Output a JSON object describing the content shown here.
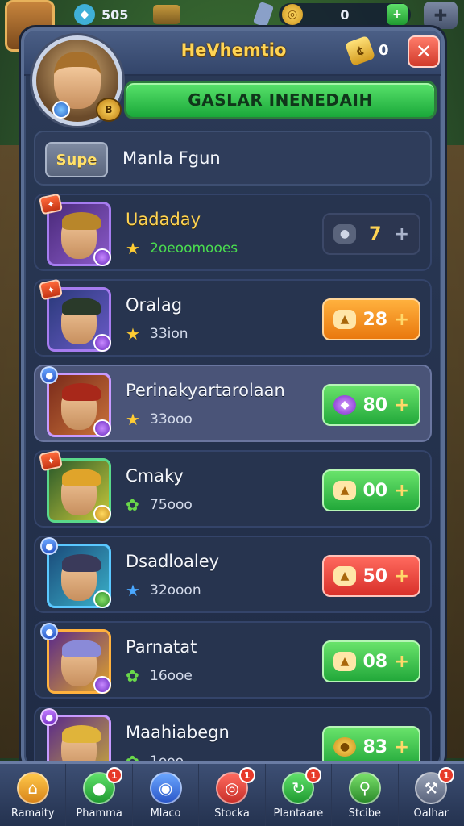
{
  "topbar": {
    "stat_a_value": "505",
    "stat_a_icon": "gem-icon",
    "gold_value": "0",
    "settings_icon": "gear-icon"
  },
  "panel": {
    "title": "HeVhemtio",
    "key_count": "0",
    "key_icon_glyph": "¢",
    "close_glyph": "✕",
    "hero_badge": "B",
    "banner_text": "GASLAR INENEDAIH"
  },
  "section": {
    "badge": "Supe",
    "title": "Manla Fgun"
  },
  "rows": [
    {
      "name": "Uadaday",
      "stat": "2oeoomooes",
      "price": "7",
      "style": "dark",
      "currency": "coin-icon"
    },
    {
      "name": "Oralag",
      "stat": "33ion",
      "price": "28",
      "style": "orange",
      "currency": "bread-icon"
    },
    {
      "name": "Perinakyartarolaan",
      "stat": "33ooo",
      "price": "80",
      "style": "green",
      "currency": "gem-icon"
    },
    {
      "name": "Cmaky",
      "stat": "75ooo",
      "price": "00",
      "style": "green",
      "currency": "bread-icon"
    },
    {
      "name": "Dsadloaley",
      "stat": "32ooon",
      "price": "50",
      "style": "red",
      "currency": "bread-icon"
    },
    {
      "name": "Parnatat",
      "stat": "16ooe",
      "price": "08",
      "style": "green",
      "currency": "bread-icon"
    },
    {
      "name": "Maahiabegn",
      "stat": "1ooo",
      "price": "83",
      "style": "green",
      "currency": "coin-icon"
    }
  ],
  "nav": [
    {
      "label": "Ramaity",
      "icon": "home-icon",
      "badge": ""
    },
    {
      "label": "Phamma",
      "icon": "chat-icon",
      "badge": "1"
    },
    {
      "label": "Mlaco",
      "icon": "search-icon",
      "badge": ""
    },
    {
      "label": "Stocka",
      "icon": "target-icon",
      "badge": "1"
    },
    {
      "label": "Plantaare",
      "icon": "refresh-icon",
      "badge": "1"
    },
    {
      "label": "Stcibe",
      "icon": "magnifier-icon",
      "badge": ""
    },
    {
      "label": "Oalhar",
      "icon": "tools-icon",
      "badge": "1"
    }
  ],
  "colors": {
    "title_gold": "#ffd454",
    "banner_green": "#22a83a",
    "pill_orange": "#e9780e",
    "pill_red": "#d8302a",
    "panel_bg": "#1f2b45"
  }
}
